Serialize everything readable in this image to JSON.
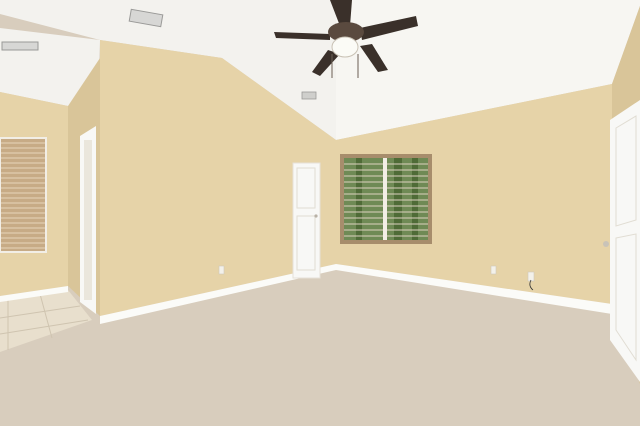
{
  "scene": {
    "kind": "empty-room-photo",
    "elements": [
      "ceiling-fan",
      "ceiling-light",
      "air-vents",
      "vaulted-ceiling",
      "window-with-blinds",
      "interior-doors",
      "open-door",
      "carpet-floor",
      "tile-floor",
      "baseboards",
      "wall-outlets"
    ]
  },
  "colors": {
    "wall": "#e6d3a8",
    "wall_shadow": "#d9c599",
    "ceiling": "#f3f2ee",
    "ceiling_right": "#f7f6f2",
    "carpet": "#d8cdbd",
    "baseboard": "#fbfbf8",
    "door": "#f8f8f6",
    "blinds": "#c7ab86",
    "tile": "#e8dfcd",
    "fan_blade": "#3a302a",
    "fan_body": "#5a4a3f",
    "window_view": "#6f8a55"
  }
}
